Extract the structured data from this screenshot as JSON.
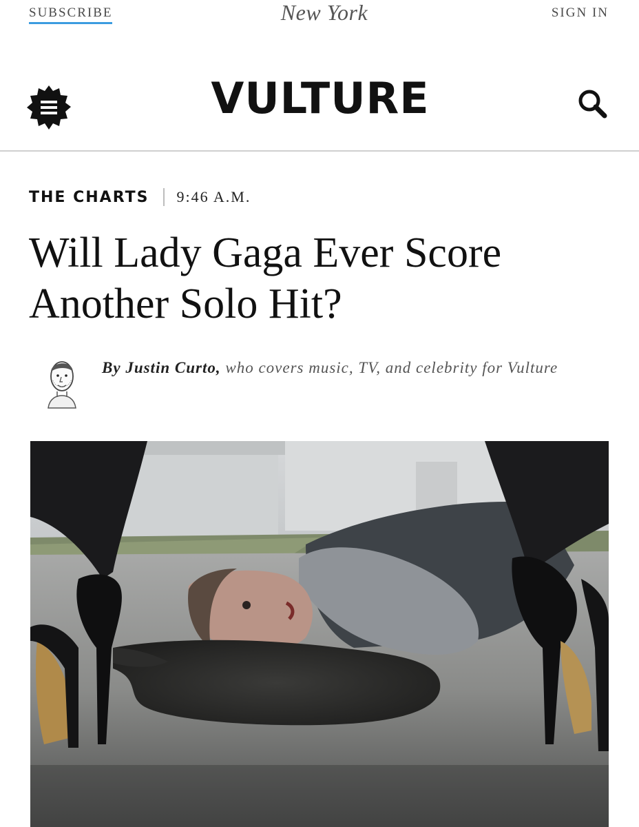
{
  "topbar": {
    "subscribe_label": "SUBSCRIBE",
    "publication": "New York",
    "signin_label": "SIGN IN"
  },
  "brand": {
    "logo_text": "VULTURE",
    "menu_icon": "hamburger-badge-icon",
    "search_icon": "magnifier-icon"
  },
  "article": {
    "rubric": "THE CHARTS",
    "timestamp": "9:46 A.M.",
    "headline": "Will Lady Gaga Ever Score Another Solo Hit?",
    "byline_prefix": "By",
    "author": "Justin Curto,",
    "author_bio": "who covers music, TV, and celebrity for Vulture",
    "avatar_icon": "author-illustration-icon"
  },
  "colors": {
    "accent_underline": "#3b9ce0",
    "divider": "#cfcfcf",
    "text": "#111111"
  }
}
